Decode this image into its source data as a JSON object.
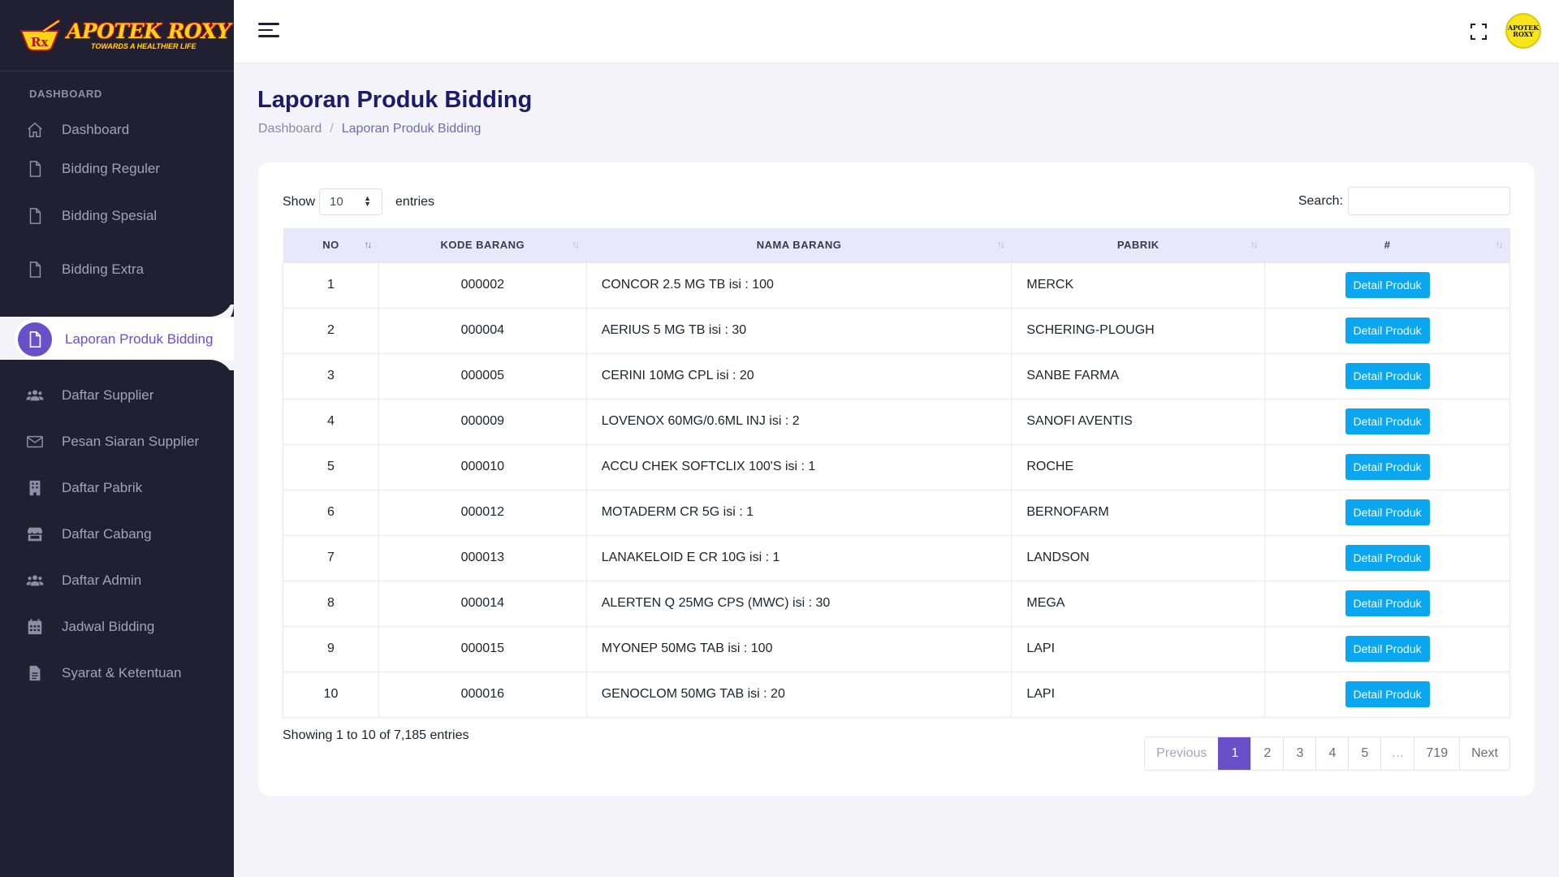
{
  "brand": {
    "title": "APOTEK ROXY",
    "tagline": "TOWARDS A HEALTHIER LIFE"
  },
  "sidebar": {
    "section_label": "DASHBOARD",
    "items": [
      {
        "label": "Dashboard",
        "icon": "home-icon"
      },
      {
        "label": "Bidding Reguler",
        "icon": "file-icon"
      },
      {
        "label": "Bidding Spesial",
        "icon": "file-icon"
      },
      {
        "label": "Bidding Extra",
        "icon": "file-icon"
      },
      {
        "label": "Laporan Produk Bidding",
        "icon": "file-icon",
        "active": true
      },
      {
        "label": "Daftar Supplier",
        "icon": "users-icon"
      },
      {
        "label": "Pesan Siaran Supplier",
        "icon": "envelope-icon"
      },
      {
        "label": "Daftar Pabrik",
        "icon": "building-icon"
      },
      {
        "label": "Daftar Cabang",
        "icon": "store-icon"
      },
      {
        "label": "Daftar Admin",
        "icon": "users-icon"
      },
      {
        "label": "Jadwal Bidding",
        "icon": "calendar-icon"
      },
      {
        "label": "Syarat & Ketentuan",
        "icon": "document-icon"
      }
    ]
  },
  "topbar": {
    "avatar_text_1": "APOTEK",
    "avatar_text_2": "ROXY"
  },
  "page": {
    "title": "Laporan Produk Bidding",
    "breadcrumb": [
      "Dashboard",
      "/",
      "Laporan Produk Bidding"
    ]
  },
  "table_controls": {
    "show_label": "Show",
    "entries_value": "10",
    "entries_label": "entries",
    "search_label": "Search:",
    "search_value": ""
  },
  "table": {
    "headers": [
      "NO",
      "KODE BARANG",
      "NAMA BARANG",
      "PABRIK",
      "#"
    ],
    "rows": [
      {
        "no": "1",
        "kode": "000002",
        "nama": "CONCOR 2.5 MG TB isi : 100",
        "pabrik": "MERCK",
        "action": "Detail Produk"
      },
      {
        "no": "2",
        "kode": "000004",
        "nama": "AERIUS 5 MG TB isi : 30",
        "pabrik": "SCHERING-PLOUGH",
        "action": "Detail Produk"
      },
      {
        "no": "3",
        "kode": "000005",
        "nama": "CERINI 10MG CPL isi : 20",
        "pabrik": "SANBE FARMA",
        "action": "Detail Produk"
      },
      {
        "no": "4",
        "kode": "000009",
        "nama": "LOVENOX 60MG/0.6ML INJ isi : 2",
        "pabrik": "SANOFI AVENTIS",
        "action": "Detail Produk"
      },
      {
        "no": "5",
        "kode": "000010",
        "nama": "ACCU CHEK SOFTCLIX 100'S isi : 1",
        "pabrik": "ROCHE",
        "action": "Detail Produk"
      },
      {
        "no": "6",
        "kode": "000012",
        "nama": "MOTADERM CR 5G isi : 1",
        "pabrik": "BERNOFARM",
        "action": "Detail Produk"
      },
      {
        "no": "7",
        "kode": "000013",
        "nama": "LANAKELOID E CR 10G isi : 1",
        "pabrik": "LANDSON",
        "action": "Detail Produk"
      },
      {
        "no": "8",
        "kode": "000014",
        "nama": "ALERTEN Q 25MG CPS (MWC) isi : 30",
        "pabrik": "MEGA",
        "action": "Detail Produk"
      },
      {
        "no": "9",
        "kode": "000015",
        "nama": "MYONEP 50MG TAB isi : 100",
        "pabrik": "LAPI",
        "action": "Detail Produk"
      },
      {
        "no": "10",
        "kode": "000016",
        "nama": "GENOCLOM 50MG TAB isi : 20",
        "pabrik": "LAPI",
        "action": "Detail Produk"
      }
    ]
  },
  "footer": {
    "info": "Showing 1 to 10 of 7,185 entries",
    "pagination": {
      "previous": "Previous",
      "pages": [
        "1",
        "2",
        "3",
        "4",
        "5"
      ],
      "ellipsis": "…",
      "last": "719",
      "next": "Next",
      "current": "1"
    }
  },
  "colors": {
    "sidebar_bg": "#212032",
    "accent": "#6a50c8",
    "button": "#0ba6f0",
    "header_bg": "#e8e8fc"
  }
}
